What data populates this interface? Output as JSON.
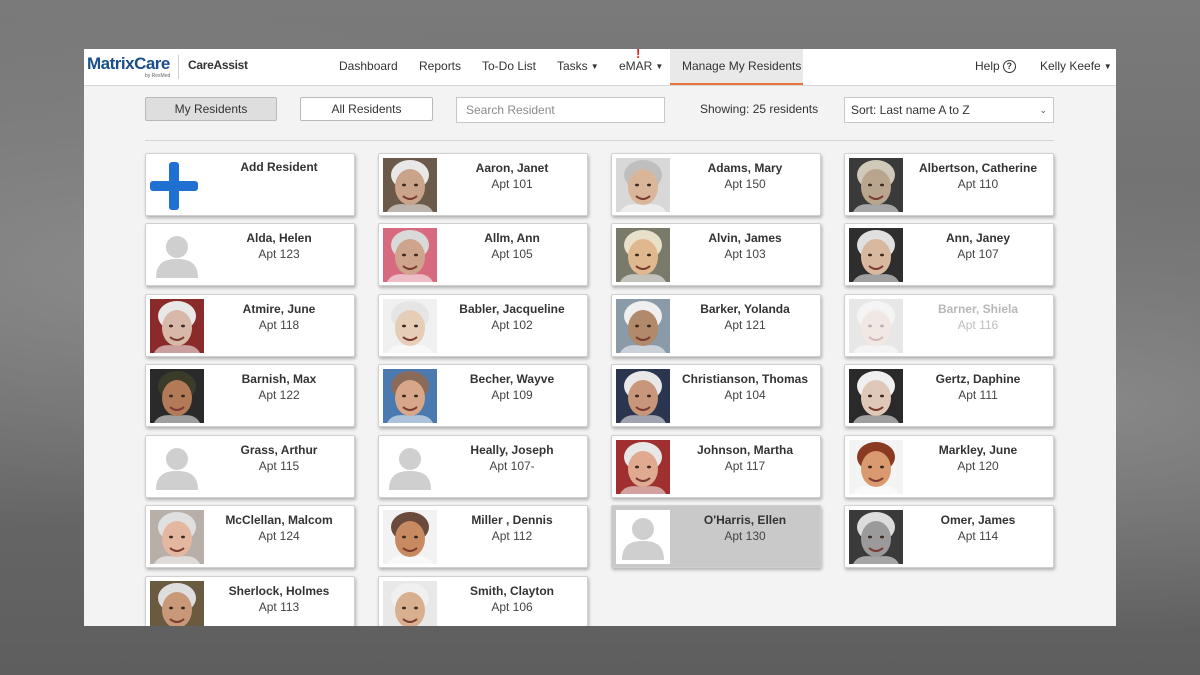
{
  "brand": {
    "logo": "MatrixCare",
    "logo_sub": "by ResMed",
    "product": "CareAssist"
  },
  "nav": {
    "dashboard": "Dashboard",
    "reports": "Reports",
    "todo": "To-Do List",
    "tasks": "Tasks",
    "emar": "eMAR",
    "emar_alert": "!",
    "manage": "Manage My Residents",
    "help": "Help",
    "help_icon": "?",
    "user": "Kelly Keefe"
  },
  "toolbar": {
    "my_residents": "My Residents",
    "all_residents": "All Residents",
    "search_placeholder": "Search Resident",
    "showing": "Showing: 25 residents",
    "sort": "Sort: Last name A to Z"
  },
  "add_resident": {
    "label": "Add Resident"
  },
  "residents": [
    {
      "name": "Aaron, Janet",
      "apt": "Apt 101",
      "photo": "photo",
      "skin": "#c9a38a",
      "hair": "#e8e8e8",
      "bg": "#6b5a4a"
    },
    {
      "name": "Adams, Mary",
      "apt": "Apt 150",
      "photo": "photo",
      "skin": "#d9b59a",
      "hair": "#bfbfbf",
      "bg": "#d8d8d8"
    },
    {
      "name": "Albertson, Catherine",
      "apt": "Apt 110",
      "photo": "photo",
      "skin": "#b9a58e",
      "hair": "#d0c8b8",
      "bg": "#3a3a3a"
    },
    {
      "name": "Alda, Helen",
      "apt": "Apt 123",
      "photo": "placeholder"
    },
    {
      "name": "Allm, Ann",
      "apt": "Apt 105",
      "photo": "photo",
      "skin": "#cfa48c",
      "hair": "#d9d9d9",
      "bg": "#d86a80"
    },
    {
      "name": "Alvin, James",
      "apt": "Apt 103",
      "photo": "photo",
      "skin": "#e0b890",
      "hair": "#e8e0c8",
      "bg": "#7a7a6a"
    },
    {
      "name": "Ann, Janey",
      "apt": "Apt 107",
      "photo": "photo",
      "skin": "#d9b8a0",
      "hair": "#e0e0e0",
      "bg": "#2e2e2e"
    },
    {
      "name": "Atmire, June",
      "apt": "Apt 118",
      "photo": "photo",
      "skin": "#d8b8a8",
      "hair": "#e8e8e8",
      "bg": "#8a2a2a"
    },
    {
      "name": "Babler, Jacqueline",
      "apt": "Apt 102",
      "photo": "photo",
      "skin": "#e6cdb8",
      "hair": "#e5e5e5",
      "bg": "#f0f0f0"
    },
    {
      "name": "Barker, Yolanda",
      "apt": "Apt 121",
      "photo": "photo",
      "skin": "#b08a6a",
      "hair": "#efefef",
      "bg": "#8a9aa8"
    },
    {
      "name": "Barner, Shiela",
      "apt": "Apt 116",
      "photo": "photo",
      "skin": "#d8c0b0",
      "hair": "#e0e0e0",
      "bg": "#bcbcbc",
      "dim": true
    },
    {
      "name": "Barnish, Max",
      "apt": "Apt 122",
      "photo": "photo",
      "skin": "#b27a56",
      "hair": "#3b3b2a",
      "bg": "#2a2a2a"
    },
    {
      "name": "Becher, Wayve",
      "apt": "Apt 109",
      "photo": "photo",
      "skin": "#d8a688",
      "hair": "#8a6a5a",
      "bg": "#4a7ab0"
    },
    {
      "name": "Christianson, Thomas",
      "apt": "Apt 104",
      "photo": "photo",
      "skin": "#c8967a",
      "hair": "#e8e8e8",
      "bg": "#2a3550"
    },
    {
      "name": "Gertz, Daphine",
      "apt": "Apt 111",
      "photo": "photo",
      "skin": "#e0c8b8",
      "hair": "#f0f0f0",
      "bg": "#2a2a2a"
    },
    {
      "name": "Grass, Arthur",
      "apt": "Apt 115",
      "photo": "placeholder"
    },
    {
      "name": "Heally, Joseph",
      "apt": "Apt 107-",
      "photo": "placeholder"
    },
    {
      "name": "Johnson, Martha",
      "apt": "Apt 117",
      "photo": "photo",
      "skin": "#e0aa90",
      "hair": "#e8e8e8",
      "bg": "#a03030"
    },
    {
      "name": "Markley, June",
      "apt": "Apt 120",
      "photo": "photo",
      "skin": "#d89a6e",
      "hair": "#8a3a20",
      "bg": "#f4f4f4"
    },
    {
      "name": "McClellan, Malcom",
      "apt": "Apt 124",
      "photo": "photo",
      "skin": "#e4b8a0",
      "hair": "#e0e0e0",
      "bg": "#b8b0a8"
    },
    {
      "name": "Miller , Dennis",
      "apt": "Apt 112",
      "photo": "photo",
      "skin": "#c88a60",
      "hair": "#6a4a3a",
      "bg": "#f2f2f2"
    },
    {
      "name": "O'Harris, Ellen",
      "apt": "Apt 130",
      "photo": "placeholder",
      "selected": true
    },
    {
      "name": "Omer, James",
      "apt": "Apt 114",
      "photo": "photo",
      "skin": "#9a9a9a",
      "hair": "#dcdcdc",
      "bg": "#3a3a3a"
    },
    {
      "name": "Sherlock, Holmes",
      "apt": "Apt 113",
      "photo": "photo",
      "skin": "#c89878",
      "hair": "#dedede",
      "bg": "#6a5a40"
    },
    {
      "name": "Smith, Clayton",
      "apt": "Apt 106",
      "photo": "photo",
      "skin": "#d8b090",
      "hair": "#f0f0f0",
      "bg": "#e8e8e8"
    }
  ]
}
